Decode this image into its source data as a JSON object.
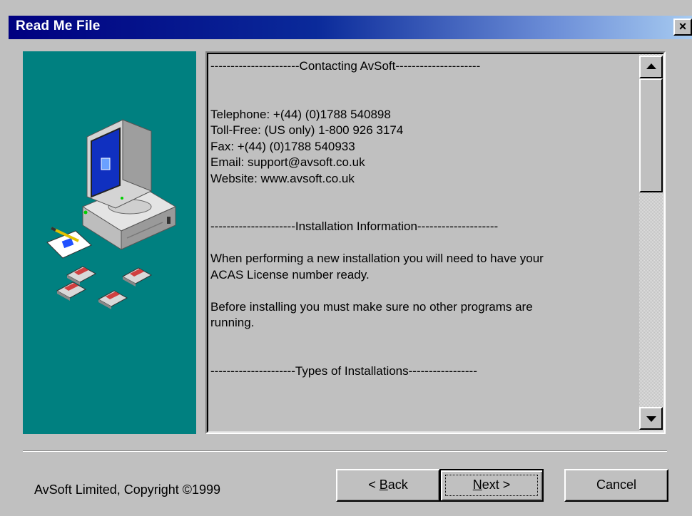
{
  "window": {
    "title": "Read Me File",
    "close_glyph": "×"
  },
  "readme": {
    "lines": [
      "----------------------Contacting AvSoft---------------------",
      "",
      "",
      "Telephone: +(44) (0)1788 540898",
      "Toll-Free: (US only) 1-800 926 3174",
      "Fax: +(44) (0)1788 540933",
      "Email: support@avsoft.co.uk",
      "Website: www.avsoft.co.uk",
      "",
      "",
      "---------------------Installation Information--------------------",
      "",
      "When performing a new installation you will need to have your",
      "ACAS License number ready.",
      "",
      "Before installing you must make sure no other programs are",
      "running.",
      "",
      "",
      "---------------------Types of Installations-----------------"
    ]
  },
  "footer": {
    "copyright": "AvSoft Limited, Copyright ©1999",
    "back_prefix": "< ",
    "back_accel": "B",
    "back_rest": "ack",
    "next_accel": "N",
    "next_rest": "ext >",
    "cancel_label": "Cancel"
  },
  "icons": {
    "close": "close-icon",
    "illustration": "computer-setup-illustration",
    "scroll_up": "scroll-up-arrow-icon",
    "scroll_down": "scroll-down-arrow-icon"
  },
  "colors": {
    "title_start": "#000080",
    "title_end": "#a6caf0",
    "side_panel": "#008080",
    "face": "#c0c0c0"
  }
}
